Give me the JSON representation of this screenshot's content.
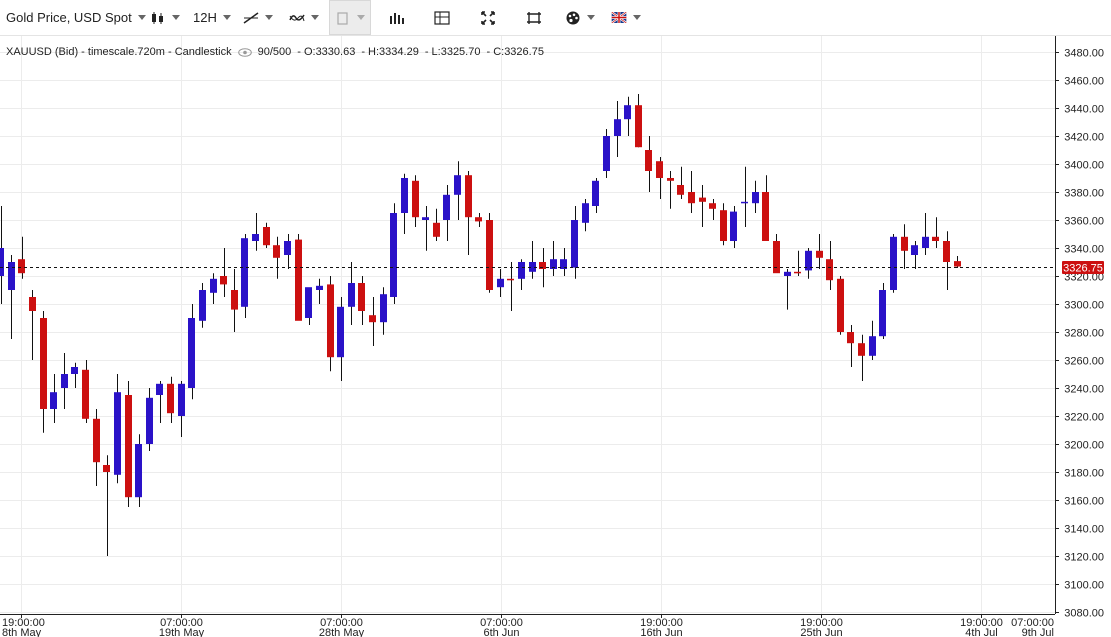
{
  "toolbar": {
    "symbol_label": "Gold Price, USD Spot",
    "timeframe_label": "12H",
    "icons": [
      "candlestick-icon",
      "line-tool-icon",
      "indicator-icon",
      "bucket-icon",
      "bar-icon",
      "crosshair-icon",
      "fullscreen-icon",
      "screenshot-icon",
      "palette-icon",
      "flag-uk-icon"
    ]
  },
  "legend": {
    "symbol": "XAUUSD (Bid) - timescale.720m - Candlestick",
    "count": "90/500",
    "open": "- O:3330.63",
    "high": "- H:3334.29",
    "low": "- L:3325.70",
    "close": "- C:3326.75"
  },
  "colors": {
    "up": "#2a12c8",
    "down": "#cc1010",
    "price_tag": "#cc1010"
  },
  "chart_data": {
    "type": "candlestick",
    "ylim": [
      3080,
      3485
    ],
    "y_ticks": [
      "3080.00",
      "3100.00",
      "3120.00",
      "3140.00",
      "3160.00",
      "3180.00",
      "3200.00",
      "3220.00",
      "3240.00",
      "3260.00",
      "3280.00",
      "3300.00",
      "3320.00",
      "3340.00",
      "3360.00",
      "3380.00",
      "3400.00",
      "3420.00",
      "3440.00",
      "3460.00",
      "3480.00"
    ],
    "x_ticks": [
      {
        "time": "19:00:00",
        "date": "8th May"
      },
      {
        "time": "07:00:00",
        "date": "19th May"
      },
      {
        "time": "07:00:00",
        "date": "28th May"
      },
      {
        "time": "07:00:00",
        "date": "6th Jun"
      },
      {
        "time": "19:00:00",
        "date": "16th Jun"
      },
      {
        "time": "19:00:00",
        "date": "25th Jun"
      },
      {
        "time": "19:00:00",
        "date": "4th Jul"
      },
      {
        "time": "07:00:00",
        "date": "9th Jul"
      }
    ],
    "last_price": "3326.75",
    "candles": [
      {
        "o": 3320,
        "h": 3370,
        "l": 3300,
        "c": 3340
      },
      {
        "o": 3310,
        "h": 3335,
        "l": 3275,
        "c": 3330
      },
      {
        "o": 3332,
        "h": 3348,
        "l": 3318,
        "c": 3322
      },
      {
        "o": 3305,
        "h": 3310,
        "l": 3260,
        "c": 3295
      },
      {
        "o": 3290,
        "h": 3295,
        "l": 3208,
        "c": 3225
      },
      {
        "o": 3225,
        "h": 3250,
        "l": 3215,
        "c": 3237
      },
      {
        "o": 3240,
        "h": 3265,
        "l": 3225,
        "c": 3250
      },
      {
        "o": 3250,
        "h": 3258,
        "l": 3240,
        "c": 3255
      },
      {
        "o": 3253,
        "h": 3260,
        "l": 3215,
        "c": 3218
      },
      {
        "o": 3218,
        "h": 3225,
        "l": 3170,
        "c": 3187
      },
      {
        "o": 3185,
        "h": 3192,
        "l": 3120,
        "c": 3180
      },
      {
        "o": 3178,
        "h": 3250,
        "l": 3172,
        "c": 3237
      },
      {
        "o": 3235,
        "h": 3245,
        "l": 3155,
        "c": 3162
      },
      {
        "o": 3162,
        "h": 3207,
        "l": 3155,
        "c": 3200
      },
      {
        "o": 3200,
        "h": 3240,
        "l": 3195,
        "c": 3233
      },
      {
        "o": 3235,
        "h": 3245,
        "l": 3215,
        "c": 3243
      },
      {
        "o": 3243,
        "h": 3248,
        "l": 3215,
        "c": 3222
      },
      {
        "o": 3220,
        "h": 3245,
        "l": 3205,
        "c": 3243
      },
      {
        "o": 3240,
        "h": 3300,
        "l": 3232,
        "c": 3290
      },
      {
        "o": 3288,
        "h": 3315,
        "l": 3283,
        "c": 3310
      },
      {
        "o": 3308,
        "h": 3322,
        "l": 3300,
        "c": 3318
      },
      {
        "o": 3320,
        "h": 3340,
        "l": 3305,
        "c": 3314
      },
      {
        "o": 3310,
        "h": 3325,
        "l": 3280,
        "c": 3296
      },
      {
        "o": 3298,
        "h": 3350,
        "l": 3290,
        "c": 3347
      },
      {
        "o": 3345,
        "h": 3365,
        "l": 3338,
        "c": 3350
      },
      {
        "o": 3355,
        "h": 3358,
        "l": 3340,
        "c": 3342
      },
      {
        "o": 3342,
        "h": 3348,
        "l": 3318,
        "c": 3333
      },
      {
        "o": 3335,
        "h": 3350,
        "l": 3325,
        "c": 3345
      },
      {
        "o": 3346,
        "h": 3350,
        "l": 3290,
        "c": 3288
      },
      {
        "o": 3290,
        "h": 3310,
        "l": 3285,
        "c": 3312
      },
      {
        "o": 3310,
        "h": 3318,
        "l": 3300,
        "c": 3313
      },
      {
        "o": 3314,
        "h": 3320,
        "l": 3252,
        "c": 3262
      },
      {
        "o": 3262,
        "h": 3305,
        "l": 3245,
        "c": 3298
      },
      {
        "o": 3298,
        "h": 3330,
        "l": 3285,
        "c": 3315
      },
      {
        "o": 3315,
        "h": 3320,
        "l": 3285,
        "c": 3295
      },
      {
        "o": 3292,
        "h": 3305,
        "l": 3270,
        "c": 3287
      },
      {
        "o": 3287,
        "h": 3312,
        "l": 3278,
        "c": 3307
      },
      {
        "o": 3305,
        "h": 3372,
        "l": 3300,
        "c": 3365
      },
      {
        "o": 3365,
        "h": 3393,
        "l": 3350,
        "c": 3390
      },
      {
        "o": 3388,
        "h": 3392,
        "l": 3355,
        "c": 3362
      },
      {
        "o": 3360,
        "h": 3370,
        "l": 3338,
        "c": 3362
      },
      {
        "o": 3358,
        "h": 3368,
        "l": 3345,
        "c": 3348
      },
      {
        "o": 3360,
        "h": 3385,
        "l": 3345,
        "c": 3378
      },
      {
        "o": 3378,
        "h": 3402,
        "l": 3360,
        "c": 3392
      },
      {
        "o": 3392,
        "h": 3395,
        "l": 3335,
        "c": 3362
      },
      {
        "o": 3362,
        "h": 3365,
        "l": 3355,
        "c": 3359
      },
      {
        "o": 3360,
        "h": 3365,
        "l": 3308,
        "c": 3310
      },
      {
        "o": 3312,
        "h": 3325,
        "l": 3305,
        "c": 3318
      },
      {
        "o": 3318,
        "h": 3330,
        "l": 3295,
        "c": 3317
      },
      {
        "o": 3318,
        "h": 3332,
        "l": 3310,
        "c": 3330
      },
      {
        "o": 3323,
        "h": 3345,
        "l": 3318,
        "c": 3330
      },
      {
        "o": 3330,
        "h": 3340,
        "l": 3312,
        "c": 3325
      },
      {
        "o": 3325,
        "h": 3345,
        "l": 3320,
        "c": 3332
      },
      {
        "o": 3325,
        "h": 3340,
        "l": 3320,
        "c": 3332
      },
      {
        "o": 3326,
        "h": 3370,
        "l": 3318,
        "c": 3360
      },
      {
        "o": 3358,
        "h": 3375,
        "l": 3352,
        "c": 3372
      },
      {
        "o": 3370,
        "h": 3390,
        "l": 3365,
        "c": 3388
      },
      {
        "o": 3395,
        "h": 3425,
        "l": 3390,
        "c": 3420
      },
      {
        "o": 3420,
        "h": 3445,
        "l": 3405,
        "c": 3432
      },
      {
        "o": 3432,
        "h": 3448,
        "l": 3420,
        "c": 3442
      },
      {
        "o": 3442,
        "h": 3450,
        "l": 3412,
        "c": 3412
      },
      {
        "o": 3410,
        "h": 3420,
        "l": 3380,
        "c": 3395
      },
      {
        "o": 3402,
        "h": 3405,
        "l": 3375,
        "c": 3390
      },
      {
        "o": 3390,
        "h": 3395,
        "l": 3368,
        "c": 3388
      },
      {
        "o": 3385,
        "h": 3398,
        "l": 3375,
        "c": 3378
      },
      {
        "o": 3380,
        "h": 3395,
        "l": 3365,
        "c": 3372
      },
      {
        "o": 3376,
        "h": 3385,
        "l": 3355,
        "c": 3373
      },
      {
        "o": 3372,
        "h": 3375,
        "l": 3360,
        "c": 3368
      },
      {
        "o": 3367,
        "h": 3372,
        "l": 3342,
        "c": 3345
      },
      {
        "o": 3345,
        "h": 3370,
        "l": 3340,
        "c": 3366
      },
      {
        "o": 3372,
        "h": 3398,
        "l": 3355,
        "c": 3373
      },
      {
        "o": 3372,
        "h": 3388,
        "l": 3365,
        "c": 3380
      },
      {
        "o": 3380,
        "h": 3392,
        "l": 3345,
        "c": 3345
      },
      {
        "o": 3345,
        "h": 3350,
        "l": 3325,
        "c": 3322
      },
      {
        "o": 3320,
        "h": 3325,
        "l": 3296,
        "c": 3323
      },
      {
        "o": 3323,
        "h": 3338,
        "l": 3320,
        "c": 3322
      },
      {
        "o": 3324,
        "h": 3340,
        "l": 3318,
        "c": 3338
      },
      {
        "o": 3338,
        "h": 3350,
        "l": 3325,
        "c": 3333
      },
      {
        "o": 3332,
        "h": 3345,
        "l": 3310,
        "c": 3317
      },
      {
        "o": 3318,
        "h": 3320,
        "l": 3278,
        "c": 3280
      },
      {
        "o": 3280,
        "h": 3285,
        "l": 3255,
        "c": 3272
      },
      {
        "o": 3272,
        "h": 3278,
        "l": 3245,
        "c": 3263
      },
      {
        "o": 3263,
        "h": 3288,
        "l": 3260,
        "c": 3277
      },
      {
        "o": 3277,
        "h": 3315,
        "l": 3275,
        "c": 3310
      },
      {
        "o": 3310,
        "h": 3350,
        "l": 3308,
        "c": 3348
      },
      {
        "o": 3348,
        "h": 3357,
        "l": 3325,
        "c": 3338
      },
      {
        "o": 3335,
        "h": 3345,
        "l": 3325,
        "c": 3342
      },
      {
        "o": 3340,
        "h": 3365,
        "l": 3335,
        "c": 3348
      },
      {
        "o": 3348,
        "h": 3362,
        "l": 3340,
        "c": 3345
      },
      {
        "o": 3345,
        "h": 3352,
        "l": 3310,
        "c": 3330
      },
      {
        "o": 3330.63,
        "h": 3334.29,
        "l": 3325.7,
        "c": 3326.75
      }
    ]
  }
}
